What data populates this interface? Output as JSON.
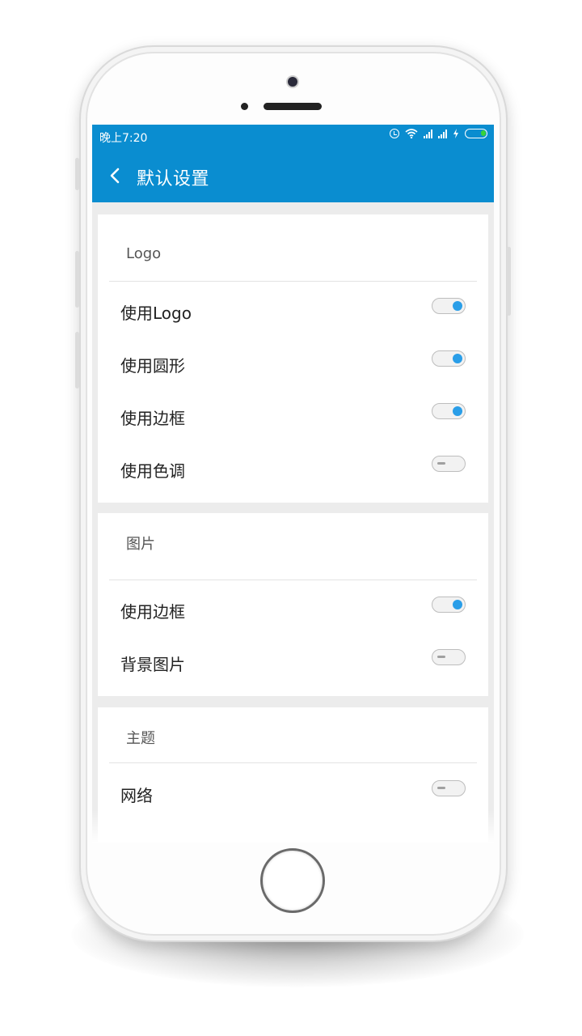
{
  "status_bar": {
    "time": "晚上7:20",
    "icons": [
      "alarm-icon",
      "wifi-icon",
      "signal-icon",
      "signal-icon",
      "charging-icon",
      "battery-icon"
    ],
    "battery_color": "#38d23a"
  },
  "app_bar": {
    "title": "默认设置",
    "color": "#0a8dd0"
  },
  "sections": [
    {
      "title": "Logo",
      "rows": [
        {
          "label": "使用Logo",
          "on": true
        },
        {
          "label": "使用圆形",
          "on": true
        },
        {
          "label": "使用边框",
          "on": true
        },
        {
          "label": "使用色调",
          "on": false
        }
      ]
    },
    {
      "title": "图片",
      "rows": [
        {
          "label": "使用边框",
          "on": true
        },
        {
          "label": "背景图片",
          "on": false
        }
      ]
    },
    {
      "title": "主题",
      "rows": [
        {
          "label": "网络",
          "on": false
        }
      ]
    }
  ],
  "accent_color": "#2a9ee8"
}
